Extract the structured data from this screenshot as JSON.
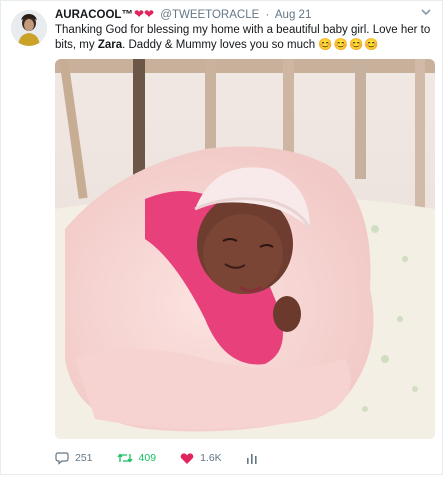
{
  "tweet": {
    "display_name": "AURACOOL™",
    "name_hearts": "❤❤",
    "handle": "@TWEETORACLE",
    "separator": "·",
    "date": "Aug 21",
    "text_part1": "Thanking God for blessing my home with a beautiful baby girl. Love her to bits, my ",
    "text_bold": "Zara",
    "text_part2": ". Daddy & Mummy loves you so much ",
    "text_emoji": "😊😊😊😊"
  },
  "actions": {
    "replies": "251",
    "retweets": "409",
    "likes": "1.6K"
  },
  "colors": {
    "accent_like": "#e0245e",
    "accent_retweet": "#17bf63",
    "secondary_text": "#657786"
  },
  "icons": {
    "reply": "reply-icon",
    "retweet": "retweet-icon",
    "like": "heart-icon",
    "analytics": "analytics-icon",
    "more": "chevron-down-icon"
  }
}
